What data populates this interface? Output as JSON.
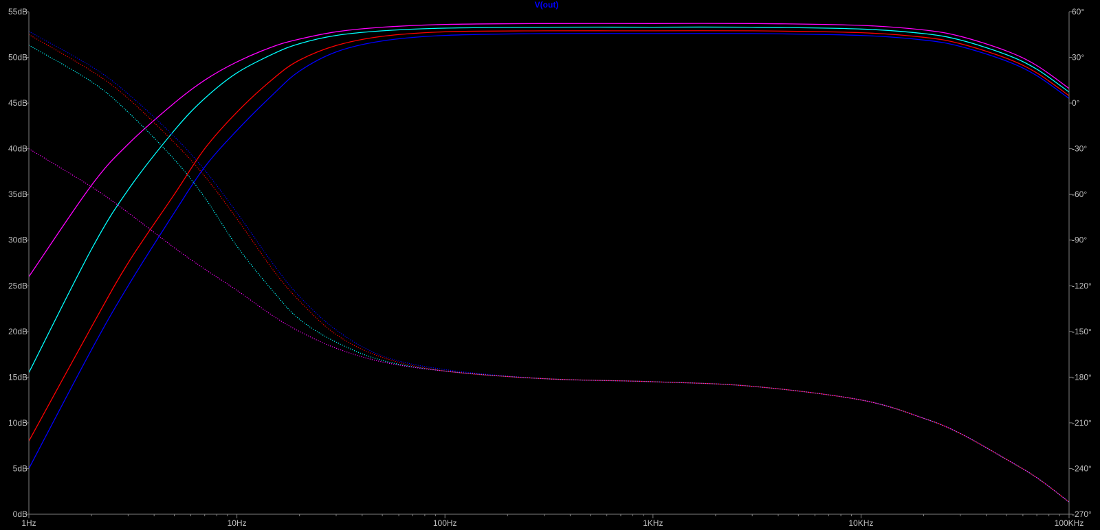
{
  "chart_data": {
    "type": "line",
    "title": "V(out)",
    "x_scale": "log",
    "xlim": [
      1,
      100000
    ],
    "ylim_left": [
      0,
      55
    ],
    "ylim_right": [
      -270,
      60
    ],
    "grid": false,
    "x_ticks": [
      {
        "value": 1,
        "label": "1Hz"
      },
      {
        "value": 10,
        "label": "10Hz"
      },
      {
        "value": 100,
        "label": "100Hz"
      },
      {
        "value": 1000,
        "label": "1KHz"
      },
      {
        "value": 10000,
        "label": "10KHz"
      },
      {
        "value": 100000,
        "label": "100KHz"
      }
    ],
    "y_ticks_left": [
      {
        "value": 0,
        "label": "0dB"
      },
      {
        "value": 5,
        "label": "5dB"
      },
      {
        "value": 10,
        "label": "10dB"
      },
      {
        "value": 15,
        "label": "15dB"
      },
      {
        "value": 20,
        "label": "20dB"
      },
      {
        "value": 25,
        "label": "25dB"
      },
      {
        "value": 30,
        "label": "30dB"
      },
      {
        "value": 35,
        "label": "35dB"
      },
      {
        "value": 40,
        "label": "40dB"
      },
      {
        "value": 45,
        "label": "45dB"
      },
      {
        "value": 50,
        "label": "50dB"
      },
      {
        "value": 55,
        "label": "55dB"
      }
    ],
    "y_ticks_right": [
      {
        "value": -270,
        "label": "-270°"
      },
      {
        "value": -240,
        "label": "-240°"
      },
      {
        "value": -210,
        "label": "-210°"
      },
      {
        "value": -180,
        "label": "-180°"
      },
      {
        "value": -150,
        "label": "-150°"
      },
      {
        "value": -120,
        "label": "-120°"
      },
      {
        "value": -90,
        "label": "-90°"
      },
      {
        "value": -60,
        "label": "-60°"
      },
      {
        "value": -30,
        "label": "-30°"
      },
      {
        "value": 0,
        "label": "0°"
      },
      {
        "value": 30,
        "label": "30°"
      },
      {
        "value": 60,
        "label": "60°"
      }
    ],
    "colors": {
      "background": "#000000",
      "axis": "#808080",
      "tick_text": "#bfbfbf",
      "title": "#0000ff"
    },
    "series": [
      {
        "color": "#0000ff",
        "kind": "magnitude",
        "axis": "left",
        "x": [
          1,
          2,
          3,
          5,
          7,
          10,
          15,
          20,
          30,
          50,
          100,
          300,
          1000,
          3000,
          10000,
          20000,
          30000,
          50000,
          70000,
          100000
        ],
        "y": [
          5,
          18,
          25,
          33,
          38,
          42,
          46,
          48.5,
          50.6,
          51.8,
          52.4,
          52.6,
          52.6,
          52.6,
          52.4,
          51.9,
          51.2,
          49.6,
          48,
          45.5
        ]
      },
      {
        "color": "#ff0000",
        "kind": "magnitude",
        "axis": "left",
        "x": [
          1,
          2,
          3,
          5,
          7,
          10,
          15,
          20,
          30,
          50,
          100,
          300,
          1000,
          3000,
          10000,
          20000,
          30000,
          50000,
          70000,
          100000
        ],
        "y": [
          8,
          20.5,
          27.5,
          35,
          40,
          44,
          47.7,
          49.7,
          51.3,
          52.3,
          52.8,
          52.9,
          52.9,
          52.9,
          52.7,
          52.2,
          51.5,
          49.9,
          48.3,
          45.8
        ]
      },
      {
        "color": "#00ffff",
        "kind": "magnitude",
        "axis": "left",
        "x": [
          1,
          2,
          3,
          5,
          7,
          10,
          15,
          20,
          30,
          50,
          100,
          300,
          1000,
          3000,
          10000,
          20000,
          30000,
          50000,
          70000,
          100000
        ],
        "y": [
          15.5,
          29,
          35.5,
          42,
          45.5,
          48.3,
          50.4,
          51.5,
          52.4,
          52.9,
          53.2,
          53.3,
          53.3,
          53.3,
          53.1,
          52.6,
          51.9,
          50.3,
          48.7,
          46.2
        ]
      },
      {
        "color": "#ff00ff",
        "kind": "magnitude",
        "axis": "left",
        "x": [
          1,
          2,
          3,
          5,
          7,
          10,
          15,
          20,
          30,
          50,
          100,
          300,
          1000,
          3000,
          10000,
          20000,
          30000,
          50000,
          70000,
          100000
        ],
        "y": [
          26,
          36,
          40.5,
          45,
          47.5,
          49.5,
          51.2,
          52,
          52.8,
          53.3,
          53.6,
          53.7,
          53.7,
          53.7,
          53.5,
          53,
          52.3,
          50.7,
          49.1,
          46.6
        ]
      },
      {
        "color": "#0000ff",
        "kind": "phase",
        "axis": "right",
        "dotted": true,
        "x": [
          1,
          2,
          3,
          5,
          7,
          10,
          15,
          20,
          30,
          50,
          100,
          300,
          1000,
          3000,
          10000,
          20000,
          30000,
          50000,
          70000,
          100000
        ],
        "y": [
          47,
          24,
          6,
          -22,
          -44,
          -72,
          -106,
          -127,
          -149,
          -166,
          -175,
          -181,
          -183,
          -186,
          -195,
          -207,
          -217,
          -234,
          -246,
          -262
        ]
      },
      {
        "color": "#ff0000",
        "kind": "phase",
        "axis": "right",
        "dotted": true,
        "x": [
          1,
          2,
          3,
          5,
          7,
          10,
          15,
          20,
          30,
          50,
          100,
          300,
          1000,
          3000,
          10000,
          20000,
          30000,
          50000,
          70000,
          100000
        ],
        "y": [
          45,
          21,
          3,
          -26,
          -48,
          -76,
          -110,
          -130,
          -152,
          -167,
          -176,
          -181,
          -183,
          -186,
          -195,
          -207,
          -217,
          -234,
          -246,
          -262
        ]
      },
      {
        "color": "#00ffff",
        "kind": "phase",
        "axis": "right",
        "dotted": true,
        "x": [
          1,
          2,
          3,
          5,
          7,
          10,
          15,
          20,
          30,
          50,
          100,
          300,
          1000,
          3000,
          10000,
          20000,
          30000,
          50000,
          70000,
          100000
        ],
        "y": [
          38,
          14,
          -6,
          -37,
          -62,
          -94,
          -124,
          -142,
          -157,
          -169,
          -176,
          -181,
          -183,
          -186,
          -195,
          -207,
          -217,
          -234,
          -246,
          -262
        ]
      },
      {
        "color": "#ff00ff",
        "kind": "phase",
        "axis": "right",
        "dotted": true,
        "x": [
          1,
          2,
          3,
          5,
          7,
          10,
          15,
          20,
          30,
          50,
          100,
          300,
          1000,
          3000,
          10000,
          20000,
          30000,
          50000,
          70000,
          100000
        ],
        "y": [
          -30,
          -55,
          -72,
          -95,
          -109,
          -123,
          -140,
          -150,
          -161,
          -170,
          -176,
          -181,
          -183,
          -186,
          -195,
          -207,
          -217,
          -234,
          -246,
          -262
        ]
      }
    ]
  }
}
